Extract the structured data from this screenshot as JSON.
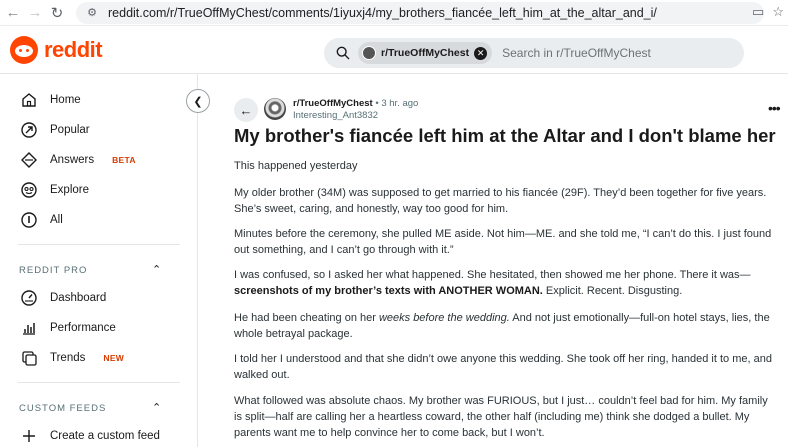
{
  "browser": {
    "url": "reddit.com/r/TrueOffMyChest/comments/1iyuxj4/my_brothers_fiancée_left_him_at_the_altar_and_i/"
  },
  "header": {
    "logo_text": "reddit",
    "search_chip": "r/TrueOffMyChest",
    "search_placeholder": "Search in r/TrueOffMyChest"
  },
  "sidebar": {
    "nav": [
      {
        "label": "Home",
        "icon": "home-icon"
      },
      {
        "label": "Popular",
        "icon": "popular-icon"
      },
      {
        "label": "Answers",
        "icon": "answers-icon",
        "badge": "BETA"
      },
      {
        "label": "Explore",
        "icon": "explore-icon"
      },
      {
        "label": "All",
        "icon": "all-icon"
      }
    ],
    "reddit_pro": {
      "label": "REDDIT PRO",
      "items": [
        {
          "label": "Dashboard",
          "icon": "dashboard-icon"
        },
        {
          "label": "Performance",
          "icon": "performance-icon"
        },
        {
          "label": "Trends",
          "icon": "trends-icon",
          "badge": "NEW"
        }
      ]
    },
    "custom_feeds": {
      "label": "CUSTOM FEEDS",
      "create_label": "Create a custom feed"
    }
  },
  "post": {
    "subreddit": "r/TrueOffMyChest",
    "time": "3 hr. ago",
    "separator": "•",
    "author": "Interesting_Ant3832",
    "title": "My brother's fiancée left him at the Altar and I don't blame her",
    "paragraphs": [
      "This happened yesterday",
      "My older brother (34M) was supposed to get married to his fiancée (29F). They’d been together for five years. She’s sweet, caring, and honestly, way too good for him.",
      "Minutes before the ceremony, she pulled ME aside. Not him—ME. and she told me, “I can’t do this. I just found out something, and I can’t go through with it.”",
      "I was confused, so I asked her what happened. She hesitated, then showed me her phone. There it was—",
      "He had been cheating on her ",
      "I told her I understood and that she didn’t owe anyone this wedding. She took off her ring, handed it to me, and walked out.",
      "What followed was absolute chaos. My brother was FURIOUS, but I just… couldn’t feel bad for him. My family is split—half are calling her a heartless coward, the other half (including me) think she dodged a bullet. My parents want me to help convince her to come back, but I won’t."
    ],
    "p4_bold": "screenshots of my brother’s texts with ANOTHER WOMAN.",
    "p4_tail": " Explicit. Recent. Disgusting.",
    "p5_italic": "weeks before the wedding.",
    "p5_tail": " And not just emotionally—full-on hotel stays, lies, the whole betrayal package."
  }
}
